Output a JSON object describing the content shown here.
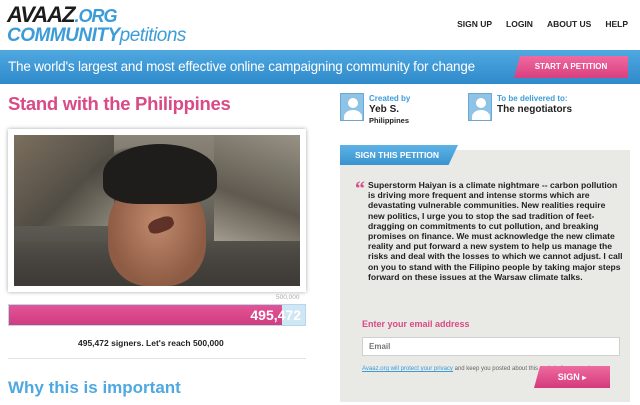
{
  "logo": {
    "brand": "AVAAZ",
    "org": ".ORG",
    "community": "COMMUNITY",
    "petitions": "petitions"
  },
  "nav": {
    "signup": "SIGN UP",
    "login": "LOGIN",
    "about": "ABOUT US",
    "help": "HELP"
  },
  "banner": {
    "tagline": "The world's largest and most effective online campaigning community for change",
    "start_button": "START A PETITION"
  },
  "petition": {
    "title": "Stand with the Philippines",
    "goal_label": "500,000",
    "signer_count": "495,472",
    "progress_fraction": 0.991,
    "signers_text": "495,472 signers. Let's reach 500,000",
    "why_heading": "Why this is important"
  },
  "creator": {
    "label": "Created by",
    "name": "Yeb S.",
    "location": "Philippines"
  },
  "target": {
    "label": "To be delivered to:",
    "name": "The negotiators"
  },
  "sign": {
    "tab_label": "SIGN THIS PETITION",
    "quote_mark": "“",
    "text": "Superstorm Haiyan is a climate nightmare -- carbon pollution is driving more frequent and intense storms which are devastating vulnerable communities. New realities require new politics, I urge you to stop the sad tradition of feet-dragging on commitments to cut pollution, and breaking promises on finance. We must acknowledge the new climate reality and put forward a new system to help us manage the risks and deal with the losses to which we cannot adjust. I call on you to stand with the Filipino people by taking major steps forward on these issues at the Warsaw climate talks.",
    "email_label": "Enter your email address",
    "email_placeholder": "Email",
    "privacy_lead": "Avaaz.org will protect your privacy",
    "privacy_rest": " and keep you posted about this and similar campaigns.",
    "button_label": "SIGN",
    "button_arrow": "▸"
  },
  "colors": {
    "accent_pink": "#d94a86",
    "accent_blue": "#3c9cd8"
  }
}
